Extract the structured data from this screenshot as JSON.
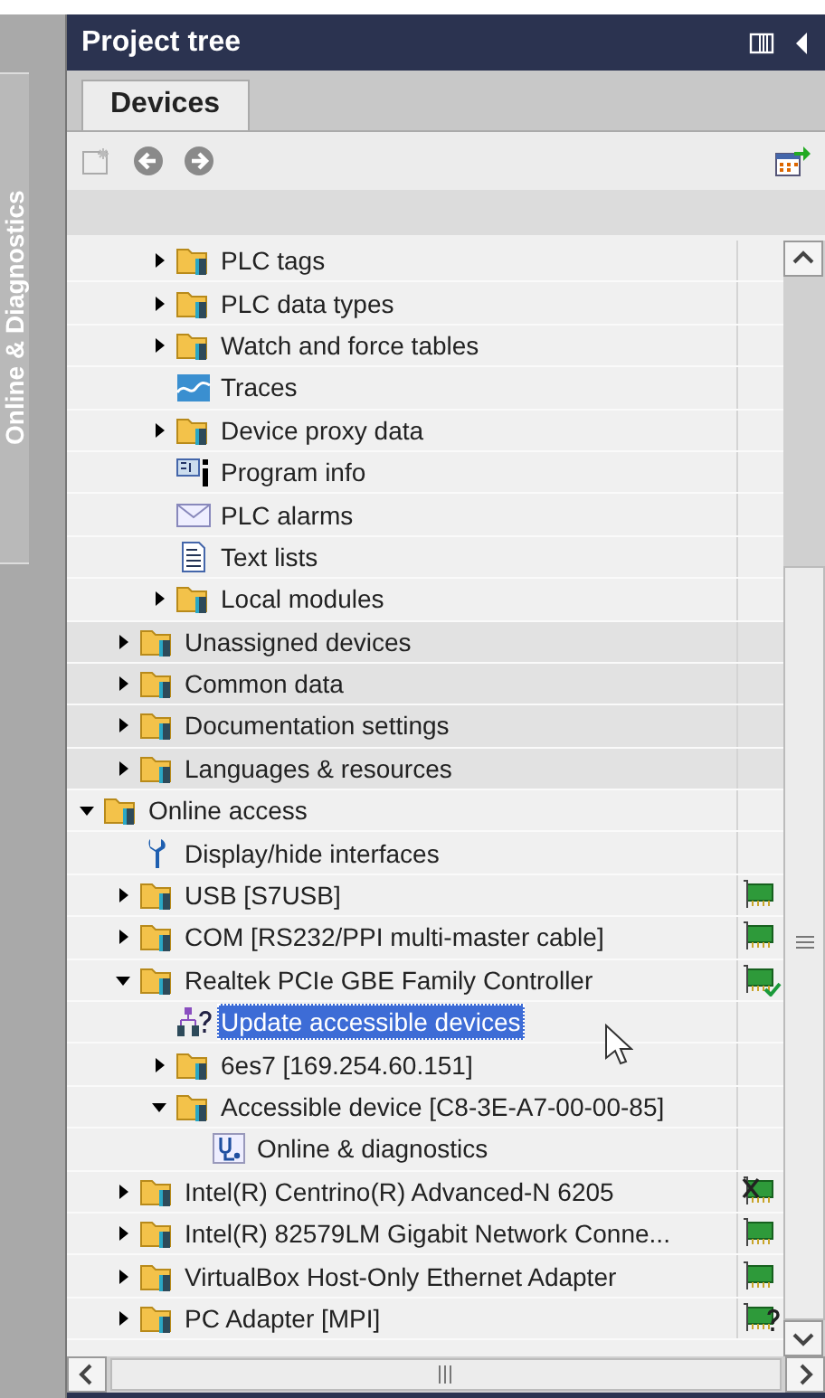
{
  "side_tab": {
    "label": "Online & Diagnostics"
  },
  "panel": {
    "title": "Project tree"
  },
  "tabs": [
    {
      "label": "Devices",
      "selected": true
    }
  ],
  "tree": {
    "scrolled_branch": [
      {
        "label": "PLC tags",
        "kind": "folder",
        "expanded": false,
        "selected": false
      },
      {
        "label": "PLC data types",
        "kind": "folder",
        "expanded": false,
        "selected": false
      },
      {
        "label": "Watch and force tables",
        "kind": "folder",
        "expanded": false,
        "selected": false
      },
      {
        "label": "Traces",
        "kind": "trace",
        "selected": false
      },
      {
        "label": "Device proxy data",
        "kind": "folder",
        "expanded": false,
        "selected": false
      },
      {
        "label": "Program info",
        "kind": "program-info",
        "selected": false
      },
      {
        "label": "PLC alarms",
        "kind": "alarm",
        "selected": false
      },
      {
        "label": "Text lists",
        "kind": "text-list",
        "selected": false
      },
      {
        "label": "Local modules",
        "kind": "folder",
        "expanded": false,
        "selected": false
      }
    ],
    "project_items": [
      {
        "label": "Unassigned devices",
        "kind": "folder",
        "expanded": false,
        "selected": false
      },
      {
        "label": "Common data",
        "kind": "folder",
        "expanded": false,
        "selected": false
      },
      {
        "label": "Documentation settings",
        "kind": "folder",
        "expanded": false,
        "selected": false
      },
      {
        "label": "Languages & resources",
        "kind": "folder",
        "expanded": false,
        "selected": false
      }
    ],
    "items": [
      {
        "label": "Online access",
        "kind": "folder",
        "expanded": true,
        "selected": false,
        "children": [
          {
            "label": "Display/hide interfaces",
            "kind": "tool",
            "selected": false
          },
          {
            "label": "USB [S7USB]",
            "kind": "folder",
            "expanded": false,
            "selected": false,
            "adapter": {
              "kind": "ready"
            }
          },
          {
            "label": "COM [RS232/PPI multi-master cable]",
            "kind": "folder",
            "expanded": false,
            "selected": false,
            "adapter": {
              "kind": "ready"
            }
          },
          {
            "label": "Realtek PCIe GBE Family Controller",
            "kind": "folder",
            "expanded": true,
            "selected": false,
            "adapter": {
              "kind": "connected"
            },
            "children": [
              {
                "label": "Update accessible devices",
                "kind": "network-query",
                "selected": true
              },
              {
                "label": "6es7 [169.254.60.151]",
                "kind": "folder",
                "expanded": false,
                "selected": false
              },
              {
                "label": "Accessible device [C8-3E-A7-00-00-85]",
                "kind": "folder",
                "expanded": true,
                "selected": false,
                "children": [
                  {
                    "label": "Online & diagnostics",
                    "kind": "diagnostics",
                    "selected": false
                  }
                ]
              }
            ]
          },
          {
            "label": "Intel(R) Centrino(R) Advanced-N 6205",
            "kind": "folder",
            "expanded": false,
            "selected": false,
            "adapter": {
              "kind": "unavailable"
            }
          },
          {
            "label": "Intel(R) 82579LM Gigabit Network Conne...",
            "kind": "folder",
            "expanded": false,
            "selected": false,
            "adapter": {
              "kind": "ready"
            }
          },
          {
            "label": "VirtualBox Host-Only Ethernet Adapter",
            "kind": "folder",
            "expanded": false,
            "selected": false,
            "adapter": {
              "kind": "ready"
            }
          },
          {
            "label": "PC Adapter [MPI]",
            "kind": "folder",
            "expanded": false,
            "selected": false,
            "adapter": {
              "kind": "unknown"
            }
          }
        ]
      }
    ]
  }
}
